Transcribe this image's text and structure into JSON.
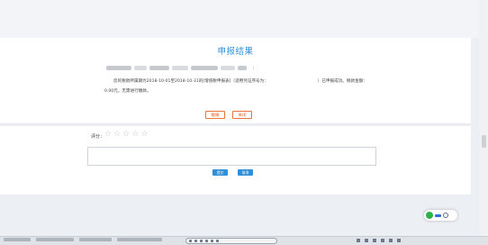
{
  "result": {
    "title": "申报结果",
    "masked_suffix": "：",
    "message_line1_a": "您的税款所属期为2018-10-01至2018-10-31的[增值税申报表]（适用凭证序号为：",
    "message_line1_b": "）已申报成功。税款金额：",
    "message_line2": "0.00元，无需进行缴款。",
    "btn_print": "缓报",
    "btn_close": "关闭"
  },
  "rating": {
    "label": "评分：",
    "stars": [
      "☆",
      "☆",
      "☆",
      "☆",
      "☆"
    ],
    "comment_value": "",
    "btn_submit": "提交",
    "btn_cancel": "取消"
  }
}
